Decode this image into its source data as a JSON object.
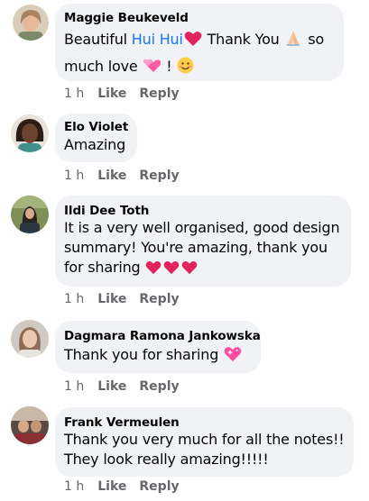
{
  "comments": [
    {
      "author": "Maggie Beukeveld",
      "text_before": "Beautiful ",
      "mention": "Hui Hui",
      "text_after_mention": " Thank You ",
      "text_line2_end": " so",
      "text_line3": "much love ",
      "text_line3_end": "!",
      "time": "1 h",
      "like": "Like",
      "reply": "Reply"
    },
    {
      "author": "Elo Violet",
      "text": "Amazing",
      "time": "1 h",
      "like": "Like",
      "reply": "Reply"
    },
    {
      "author": "Ildi Dee Toth",
      "line1": "It is a very well organised, good design",
      "line2": "summary! You're amazing, thank you",
      "line3": "for sharing",
      "time": "1 h",
      "like": "Like",
      "reply": "Reply"
    },
    {
      "author": "Dagmara Ramona Jankowska",
      "text": "Thank you for sharing",
      "time": "1 h",
      "like": "Like",
      "reply": "Reply"
    },
    {
      "author": "Frank Vermeulen",
      "line1": "Thank you very much for all the notes!!",
      "line2": "They look really amazing!!!!!",
      "time": "1 h",
      "like": "Like",
      "reply": "Reply"
    }
  ],
  "icons": {
    "heart": "red-heart-icon",
    "folded_hands": "folded-hands-icon",
    "pink_hearts": "two-pink-hearts-icon",
    "smile": "smiling-face-icon",
    "sparkling_heart": "sparkling-heart-icon"
  },
  "colors": {
    "bubble": "#f0f2f5",
    "mention": "#1877f2",
    "meta": "#65676b",
    "heart": "#e0245e"
  }
}
